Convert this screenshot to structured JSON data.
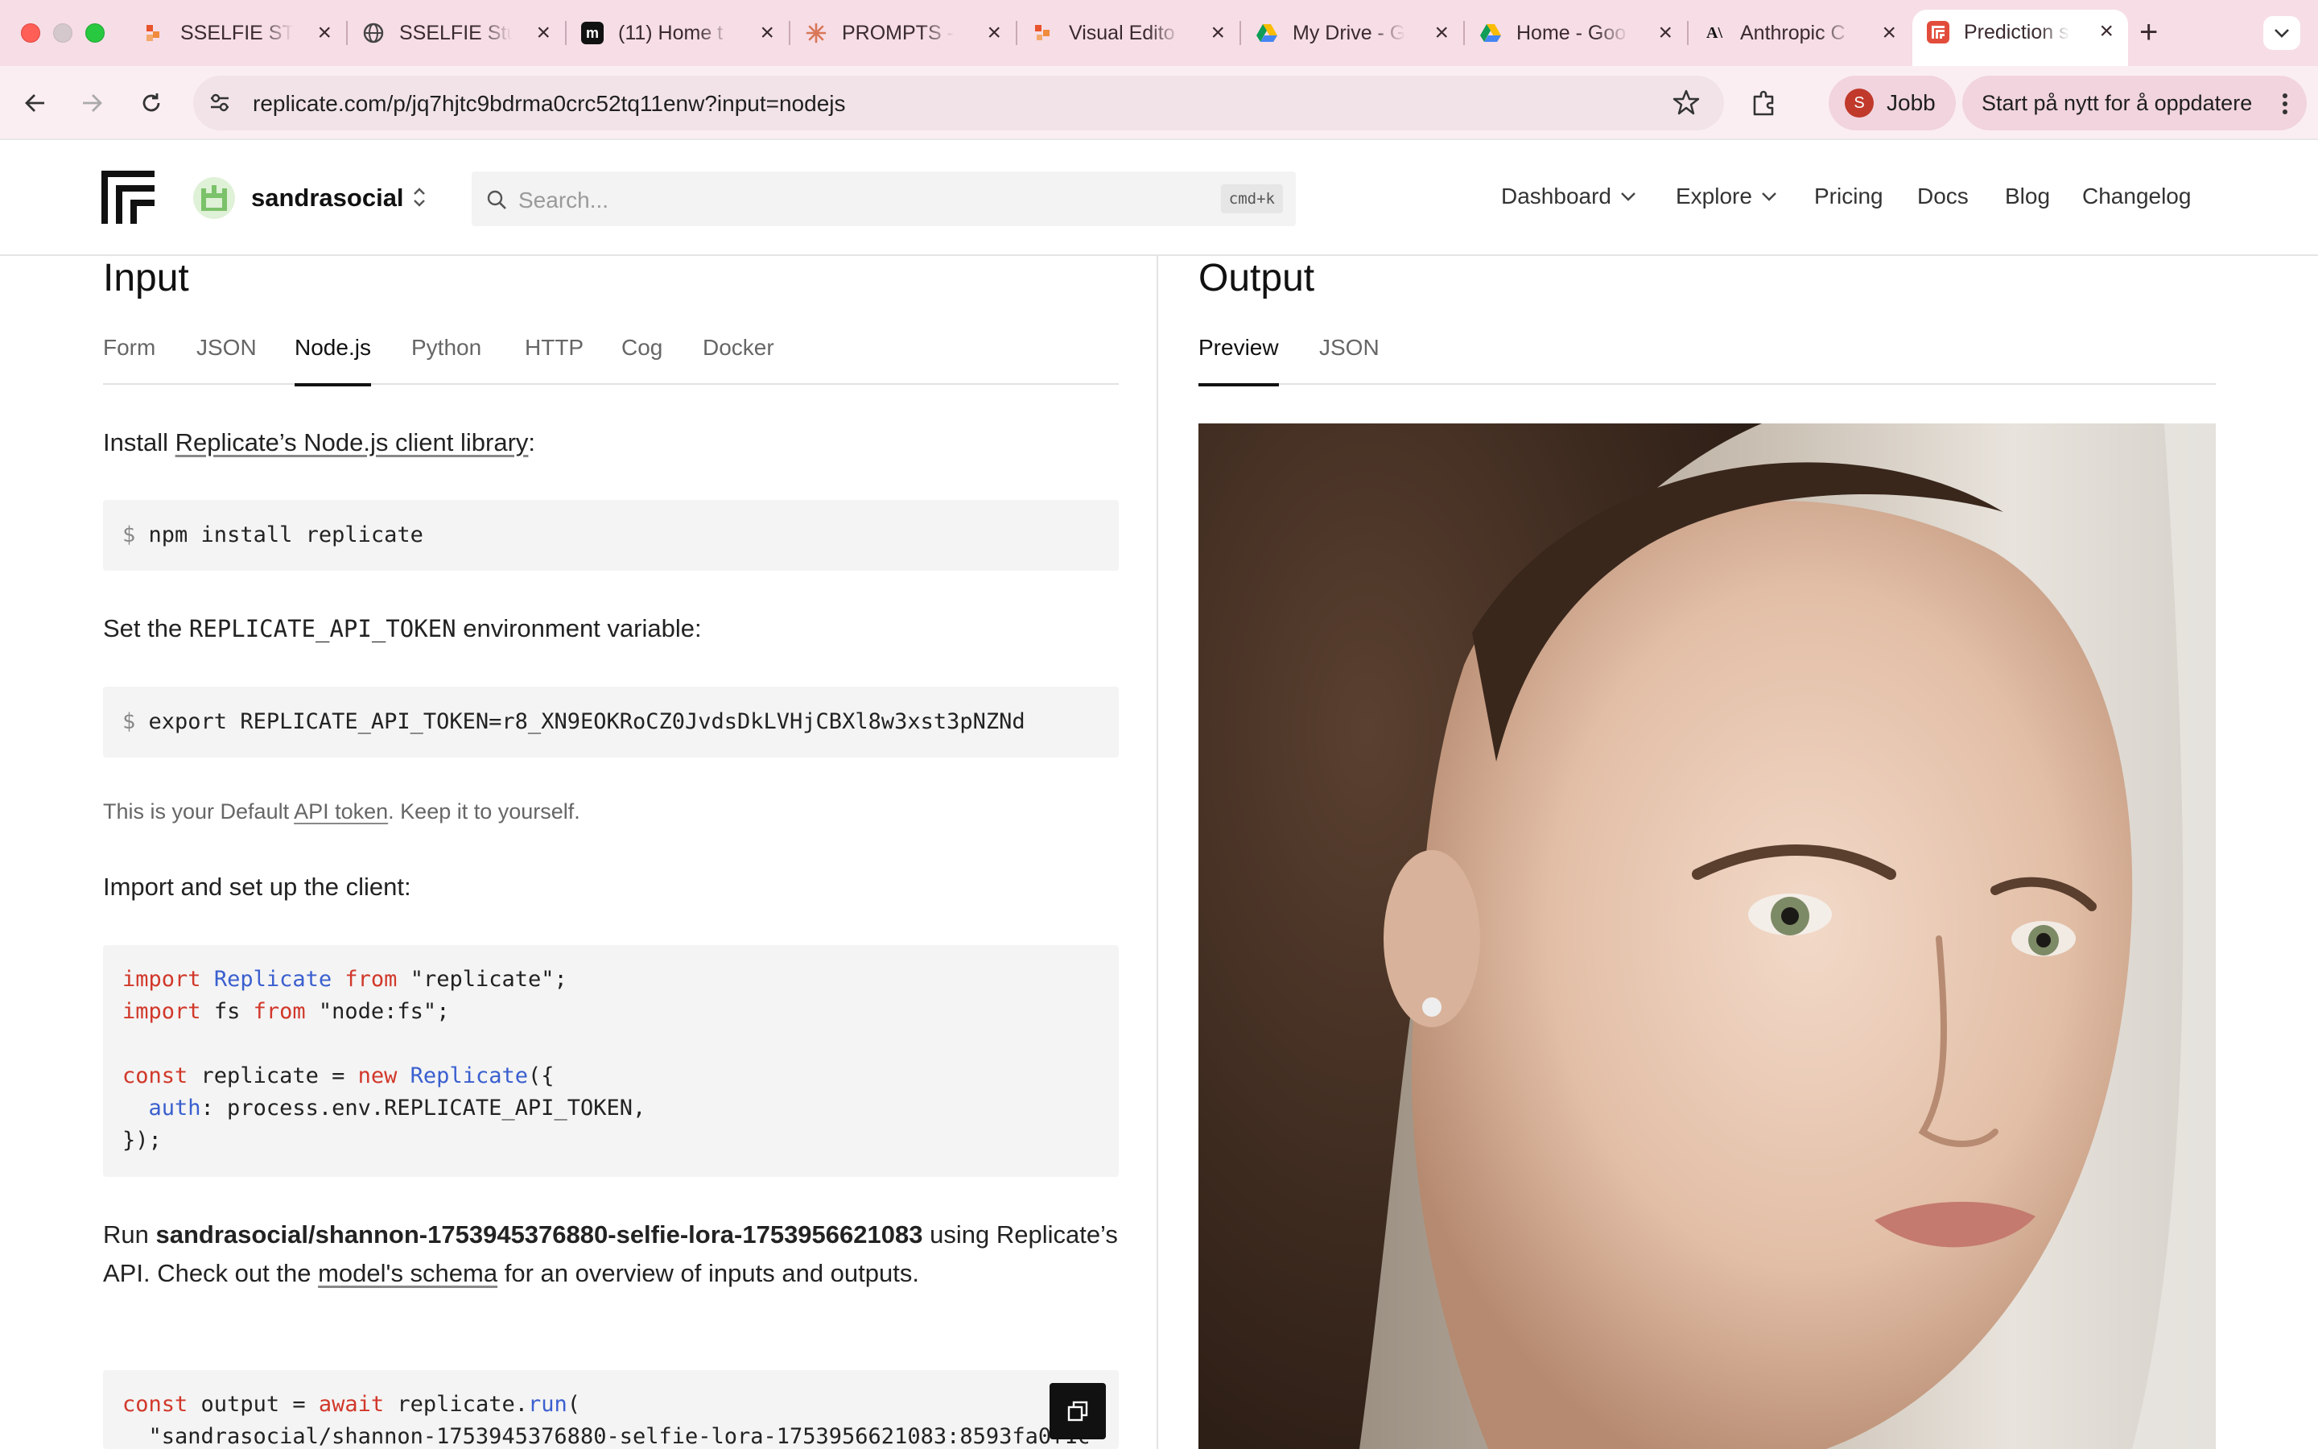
{
  "browser": {
    "tabs": [
      {
        "title": "SSELFIE ST",
        "icon": "figma-like-orange-icon"
      },
      {
        "title": "SSELFIE Stu",
        "icon": "globe-icon"
      },
      {
        "title": "(11) Home t",
        "icon": "m-logo-icon"
      },
      {
        "title": "PROMPTS -",
        "icon": "claude-sunburst-icon"
      },
      {
        "title": "Visual Edito",
        "icon": "orange-squares-icon"
      },
      {
        "title": "My Drive - G",
        "icon": "google-drive-icon"
      },
      {
        "title": "Home - Goo",
        "icon": "google-drive-icon"
      },
      {
        "title": "Anthropic C",
        "icon": "anthropic-logo-icon"
      },
      {
        "title": "Prediction s",
        "icon": "replicate-logo-icon",
        "active": true
      }
    ],
    "url": "replicate.com/p/jq7hjtc9bdrma0crc52tq11enw?input=nodejs",
    "profile": {
      "initial": "S",
      "name": "Jobb"
    },
    "update_label": "Start på nytt for å oppdatere"
  },
  "header": {
    "org_name": "sandrasocial",
    "search_placeholder": "Search...",
    "search_shortcut": "cmd+k",
    "nav": [
      "Dashboard",
      "Explore",
      "Pricing",
      "Docs",
      "Blog",
      "Changelog"
    ]
  },
  "input": {
    "title": "Input",
    "tabs": [
      "Form",
      "JSON",
      "Node.js",
      "Python",
      "HTTP",
      "Cog",
      "Docker"
    ],
    "active_tab": "Node.js",
    "install_prefix": "Install ",
    "install_link": "Replicate’s Node.js client library",
    "install_suffix": ":",
    "install_prompt": "$",
    "install_cmd": "npm install replicate",
    "env_prefix": "Set the ",
    "env_var": "REPLICATE_API_TOKEN",
    "env_suffix": " environment variable:",
    "export_prompt": "$",
    "export_cmd": "export REPLICATE_API_TOKEN=r8_XN9EOKRoCZ0JvdsDkLVHjCBXl8w3xst3pNZNd",
    "token_note_prefix": "This is your Default ",
    "token_note_link": "API token",
    "token_note_suffix": ". Keep it to yourself.",
    "import_heading": "Import and set up the client:",
    "code": {
      "l1_kw": "import",
      "l1_ty": "Replicate",
      "l1_from": "from",
      "l1_str": "\"replicate\";",
      "l2_kw": "import",
      "l2_id": "fs",
      "l2_from": "from",
      "l2_str": "\"node:fs\";",
      "l3_kw": "const",
      "l3_id": "replicate =",
      "l3_new": "new",
      "l3_ty": "Replicate",
      "l3_end": "({",
      "l4_key": "auth",
      "l4_rest": ": process.env.REPLICATE_API_TOKEN,",
      "l5": "});"
    },
    "run_prefix": "Run ",
    "run_model": "sandrasocial/shannon-1753945376880-selfie-lora-1753956621083",
    "run_mid": " using Replicate’s API. Check out the ",
    "run_link": "model's schema",
    "run_suffix": " for an overview of inputs and outputs.",
    "run_code": {
      "kw1": "const",
      "id1": "output =",
      "kw2": "await",
      "id2": "replicate.",
      "fn": "run",
      "end": "(",
      "line2": "  \"sandrasocial/shannon-1753945376880-selfie-lora-1753956621083:8593fa0f1c"
    }
  },
  "output": {
    "title": "Output",
    "tabs": [
      "Preview",
      "JSON"
    ],
    "active_tab": "Preview"
  }
}
